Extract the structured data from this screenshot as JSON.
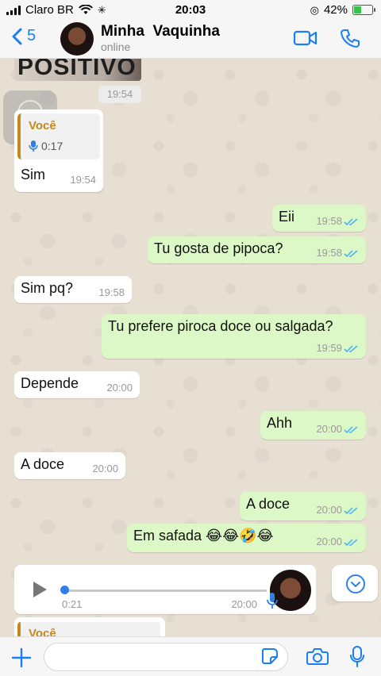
{
  "status_bar": {
    "carrier": "Claro BR",
    "time": "20:03",
    "battery": "42%",
    "battery_level": 0.42
  },
  "header": {
    "back_count": "5",
    "contact_name": "Minha  Vaquinha",
    "contact_status": "online"
  },
  "chat": {
    "image_caption_text": "POSITIVO",
    "image_time": "19:54",
    "reply_quote": {
      "author": "Você",
      "duration": "0:17"
    },
    "messages": [
      {
        "text": "Sim",
        "time": "19:54",
        "dir": "in"
      },
      {
        "text": "Eii",
        "time": "19:58",
        "dir": "out"
      },
      {
        "text": "Tu gosta de pipoca?",
        "time": "19:58",
        "dir": "out"
      },
      {
        "text": "Sim pq?",
        "time": "19:58",
        "dir": "in"
      },
      {
        "text": "Tu prefere piroca doce ou salgada?",
        "time": "19:59",
        "dir": "out"
      },
      {
        "text": "Depende",
        "time": "20:00",
        "dir": "in"
      },
      {
        "text": "Ahh",
        "time": "20:00",
        "dir": "out"
      },
      {
        "text": "A doce",
        "time": "20:00",
        "dir": "in"
      },
      {
        "text": "A doce",
        "time": "20:00",
        "dir": "out"
      },
      {
        "text": "Em safada 😂😂🤣😂",
        "time": "20:00",
        "dir": "out"
      }
    ],
    "voice_message": {
      "duration": "0:21",
      "time": "20:00",
      "progress": 0.0
    },
    "partial_quote_author": "Você"
  },
  "colors": {
    "accent": "#1a7ff5",
    "outgoing_bubble": "#dcf8c6",
    "incoming_bubble": "#ffffff",
    "read_ticks": "#4fb6ec",
    "quote_author": "#c28a1a"
  },
  "icons": [
    "back-chevron-icon",
    "video-call-icon",
    "phone-icon",
    "mic-icon",
    "play-icon",
    "chevron-down-icon",
    "plus-icon",
    "sticker-icon",
    "camera-icon"
  ]
}
